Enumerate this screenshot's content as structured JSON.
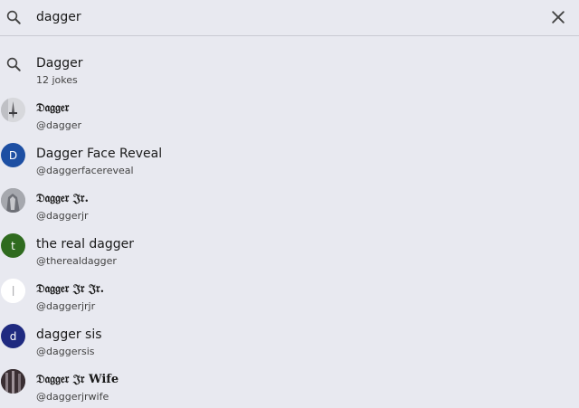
{
  "search": {
    "value": "dagger",
    "placeholder": ""
  },
  "results": [
    {
      "kind": "query",
      "title": "Dagger",
      "subtitle": "12 jokes",
      "icon": "search-icon"
    },
    {
      "kind": "user",
      "title": "𝔇𝔞𝔤𝔤𝔢𝔯",
      "subtitle": "@dagger",
      "avatar": "photo",
      "avatar_color": "#cfd0d4"
    },
    {
      "kind": "user",
      "title": "Dagger Face Reveal",
      "subtitle": "@daggerfacereveal",
      "avatar_letter": "D",
      "avatar_color": "#1d4fa3"
    },
    {
      "kind": "user",
      "title": "𝔇𝔞𝔤𝔤𝔢𝔯 𝔍𝔯.",
      "subtitle": "@daggerjr",
      "avatar": "photo",
      "avatar_color": "#9a9ca3"
    },
    {
      "kind": "user",
      "title": "the real dagger",
      "subtitle": "@therealdagger",
      "avatar_letter": "t",
      "avatar_color": "#2f6b1f"
    },
    {
      "kind": "user",
      "title": "𝔇𝔞𝔤𝔤𝔢𝔯 𝔍𝔯 𝔍𝔯.",
      "subtitle": "@daggerjrjr",
      "avatar": "photo",
      "avatar_color": "#ffffff"
    },
    {
      "kind": "user",
      "title": "dagger sis",
      "subtitle": "@daggersis",
      "avatar_letter": "d",
      "avatar_color": "#1f2a80"
    },
    {
      "kind": "user",
      "title": "𝔇𝔞𝔤𝔤𝔢𝔯 𝔍𝔯 Wife",
      "subtitle": "@daggerjrwife",
      "avatar": "photo",
      "avatar_color": "#3a2f33"
    }
  ],
  "colors": {
    "background": "#e8e9f0",
    "divider": "#c9cad3",
    "icon": "#444444"
  }
}
